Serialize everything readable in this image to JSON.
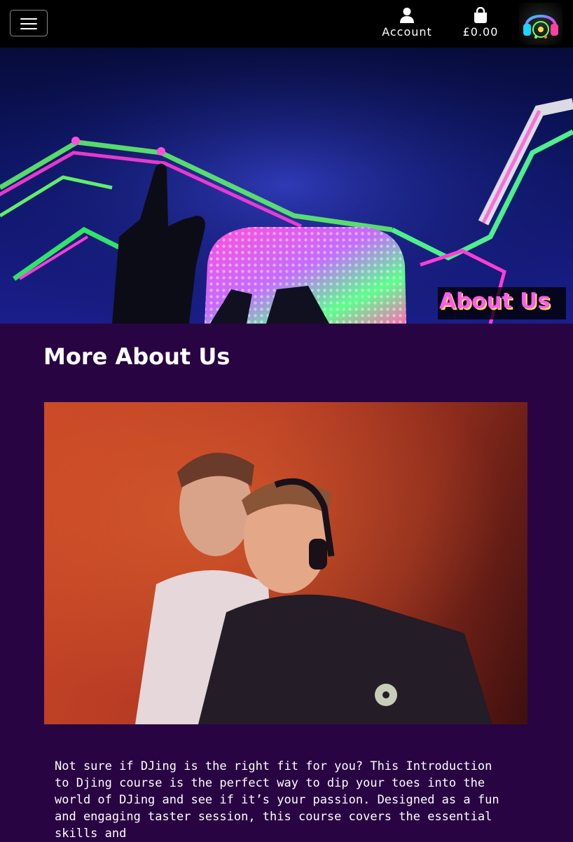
{
  "navbar": {
    "account_label": "Account",
    "basket_total": "£0.00",
    "icons": [
      "menu-icon",
      "user-icon",
      "shopping-bag-icon",
      "headphones-logo"
    ]
  },
  "hero": {
    "caption": "About Us"
  },
  "main": {
    "heading": "More About Us",
    "paragraph": "Not sure if DJing is the right fit for you? This Introduction to Djing course is the perfect way to dip your toes into the world of DJing and see if it’s your passion. Designed as a fun and engaging taster session, this course covers the essential skills and"
  },
  "colors": {
    "page_background": "#290442",
    "navbar_background": "#000000",
    "caption_text": "#ff5bf2",
    "caption_shadow": "#ffe14a"
  }
}
